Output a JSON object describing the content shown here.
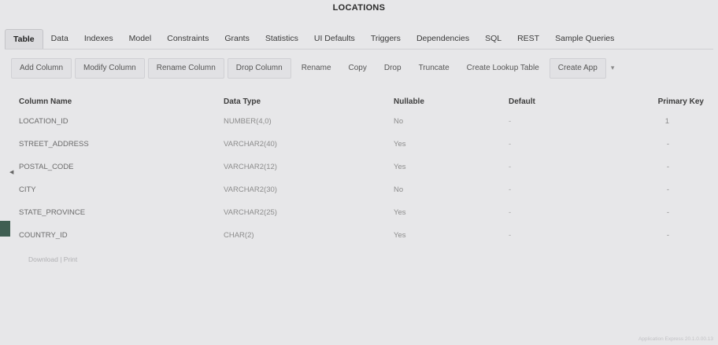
{
  "page_title": "LOCATIONS",
  "tabs": [
    {
      "label": "Table",
      "active": true
    },
    {
      "label": "Data"
    },
    {
      "label": "Indexes"
    },
    {
      "label": "Model"
    },
    {
      "label": "Constraints"
    },
    {
      "label": "Grants"
    },
    {
      "label": "Statistics"
    },
    {
      "label": "UI Defaults"
    },
    {
      "label": "Triggers"
    },
    {
      "label": "Dependencies"
    },
    {
      "label": "SQL"
    },
    {
      "label": "REST"
    },
    {
      "label": "Sample Queries"
    }
  ],
  "toolbar": {
    "add_column": "Add Column",
    "modify_column": "Modify Column",
    "rename_column": "Rename Column",
    "drop_column": "Drop Column",
    "rename": "Rename",
    "copy": "Copy",
    "drop": "Drop",
    "truncate": "Truncate",
    "create_lookup_table": "Create Lookup Table",
    "create_app": "Create App"
  },
  "columns_table": {
    "headers": {
      "column_name": "Column Name",
      "data_type": "Data Type",
      "nullable": "Nullable",
      "default": "Default",
      "primary_key": "Primary Key"
    },
    "rows": [
      {
        "name": "LOCATION_ID",
        "type": "NUMBER(4,0)",
        "nullable": "No",
        "default": "-",
        "pk": "1"
      },
      {
        "name": "STREET_ADDRESS",
        "type": "VARCHAR2(40)",
        "nullable": "Yes",
        "default": "-",
        "pk": "-"
      },
      {
        "name": "POSTAL_CODE",
        "type": "VARCHAR2(12)",
        "nullable": "Yes",
        "default": "-",
        "pk": "-"
      },
      {
        "name": "CITY",
        "type": "VARCHAR2(30)",
        "nullable": "No",
        "default": "-",
        "pk": "-"
      },
      {
        "name": "STATE_PROVINCE",
        "type": "VARCHAR2(25)",
        "nullable": "Yes",
        "default": "-",
        "pk": "-"
      },
      {
        "name": "COUNTRY_ID",
        "type": "CHAR(2)",
        "nullable": "Yes",
        "default": "-",
        "pk": "-"
      }
    ]
  },
  "footer": {
    "download": "Download",
    "separator": "|",
    "print": "Print"
  },
  "copyright": "Application Express 20.1.0.00.13"
}
